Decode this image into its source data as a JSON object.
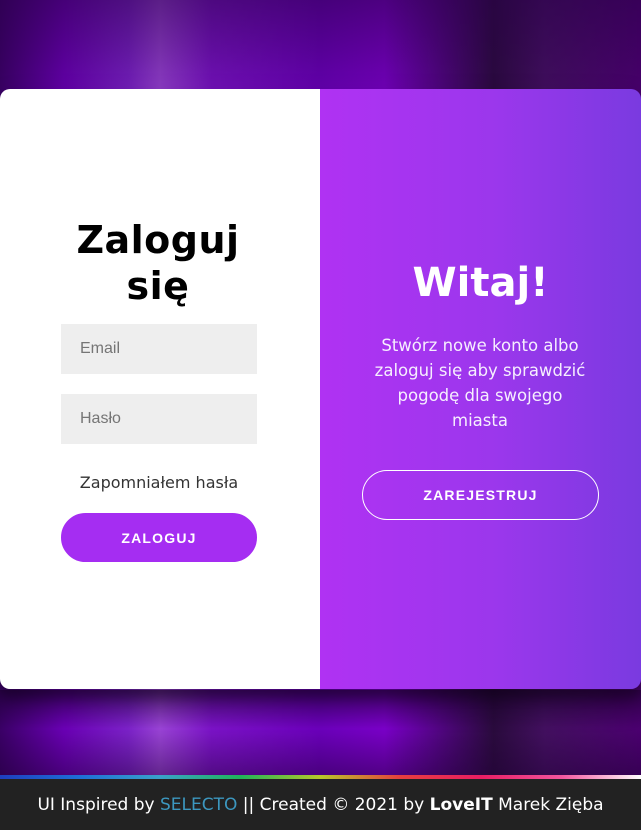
{
  "login": {
    "title_line1": "Zaloguj",
    "title_line2": "się",
    "email_placeholder": "Email",
    "password_placeholder": "Hasło",
    "forgot_label": "Zapomniałem hasła",
    "submit_label": "ZALOGUJ"
  },
  "welcome": {
    "title": "Witaj!",
    "text": "Stwórz nowe konto albo zaloguj się aby sprawdzić pogodę dla swojego miasta",
    "register_label": "ZAREJESTRUJ"
  },
  "footer": {
    "prefix": "UI Inspired by",
    "link_label": "SELECTO",
    "middle": "|| Created © 2021 by",
    "brand": "LoveIT",
    "author": "Marek Zięba"
  },
  "colors": {
    "accent": "#a52df2",
    "link": "#3c97bf",
    "footer_bg": "#222222"
  }
}
